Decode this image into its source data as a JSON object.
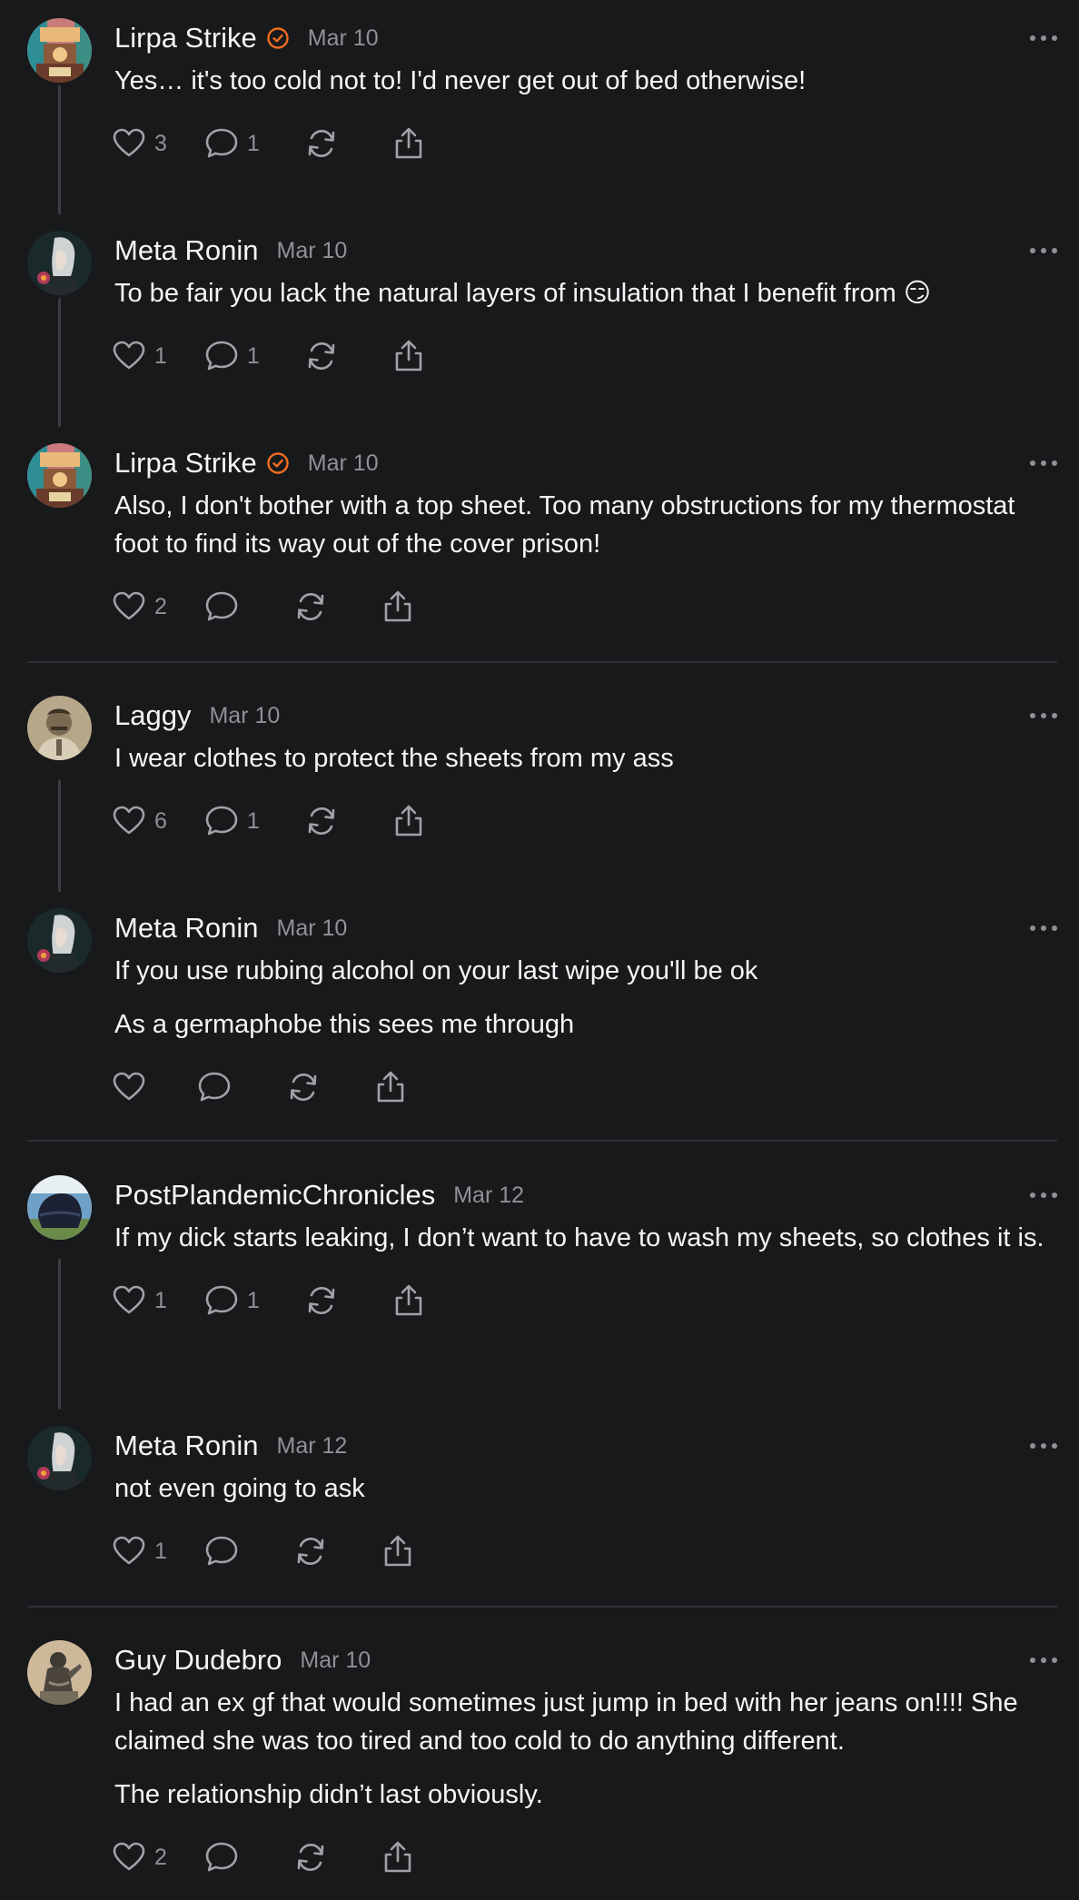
{
  "posts": [
    {
      "username": "Lirpa Strike",
      "verified": true,
      "date": "Mar 10",
      "paragraphs": [
        "Yes… it's too cold not to! I'd never get out of bed otherwise!"
      ],
      "likes": "3",
      "replies": "1",
      "avatar_icon": "avatar-lirpa-icon"
    },
    {
      "username": "Meta Ronin",
      "verified": false,
      "date": "Mar 10",
      "paragraphs": [
        "To be fair you lack the natural layers of insulation that I benefit from 😏"
      ],
      "likes": "1",
      "replies": "1",
      "avatar_icon": "avatar-meta-ronin-icon"
    },
    {
      "username": "Lirpa Strike",
      "verified": true,
      "date": "Mar 10",
      "paragraphs": [
        "Also, I don't bother with a top sheet. Too many obstructions for my thermostat foot to find its way out of the cover prison!"
      ],
      "likes": "2",
      "replies": "",
      "avatar_icon": "avatar-lirpa-icon"
    },
    {
      "username": "Laggy",
      "verified": false,
      "date": "Mar 10",
      "paragraphs": [
        "I wear clothes to protect the sheets from my ass"
      ],
      "likes": "6",
      "replies": "1",
      "avatar_icon": "avatar-laggy-icon"
    },
    {
      "username": "Meta Ronin",
      "verified": false,
      "date": "Mar 10",
      "paragraphs": [
        "If you use rubbing alcohol on your last wipe you'll be ok",
        "As a germaphobe this sees me through"
      ],
      "likes": "",
      "replies": "",
      "avatar_icon": "avatar-meta-ronin-icon"
    },
    {
      "username": "PostPlandemicChronicles",
      "verified": false,
      "date": "Mar 12",
      "paragraphs": [
        "If my dick starts leaking, I don’t want to have to wash my sheets, so clothes it is."
      ],
      "likes": "1",
      "replies": "1",
      "avatar_icon": "avatar-postplandemic-icon"
    },
    {
      "username": "Meta Ronin",
      "verified": false,
      "date": "Mar 12",
      "paragraphs": [
        "not even going to ask"
      ],
      "likes": "1",
      "replies": "",
      "avatar_icon": "avatar-meta-ronin-icon"
    },
    {
      "username": "Guy Dudebro",
      "verified": false,
      "date": "Mar 10",
      "paragraphs": [
        "I had an ex gf that would sometimes just jump in bed with her jeans on!!!! She claimed she was too tired and too cold to do anything different.",
        "The relationship didn’t last obviously."
      ],
      "likes": "2",
      "replies": "",
      "avatar_icon": "avatar-guy-dudebro-icon"
    }
  ],
  "colors": {
    "background": "#18191b",
    "text": "#f3f5f7",
    "muted": "#8f9195",
    "verified": "#f26d21",
    "divider": "#2d2f33"
  }
}
